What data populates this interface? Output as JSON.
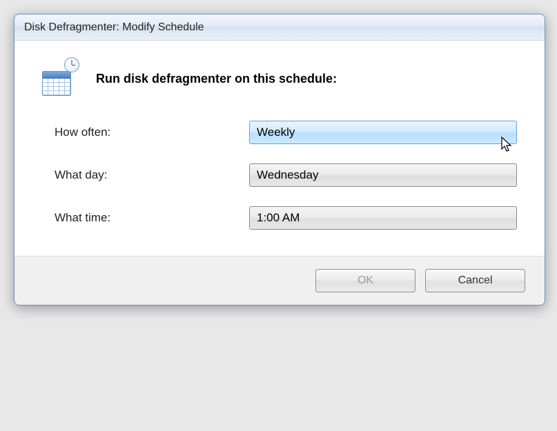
{
  "window": {
    "title": "Disk Defragmenter: Modify Schedule"
  },
  "heading": "Run disk defragmenter on this schedule:",
  "labels": {
    "howOften": "How often:",
    "whatDay": "What day:",
    "whatTime": "What time:"
  },
  "dropdowns": {
    "howOften": {
      "value": "Weekly"
    },
    "whatDay": {
      "value": "Wednesday"
    },
    "whatTime": {
      "value": "1:00 AM"
    }
  },
  "buttons": {
    "ok": "OK",
    "cancel": "Cancel"
  },
  "icons": {
    "calendar": "calendar-clock-icon"
  }
}
